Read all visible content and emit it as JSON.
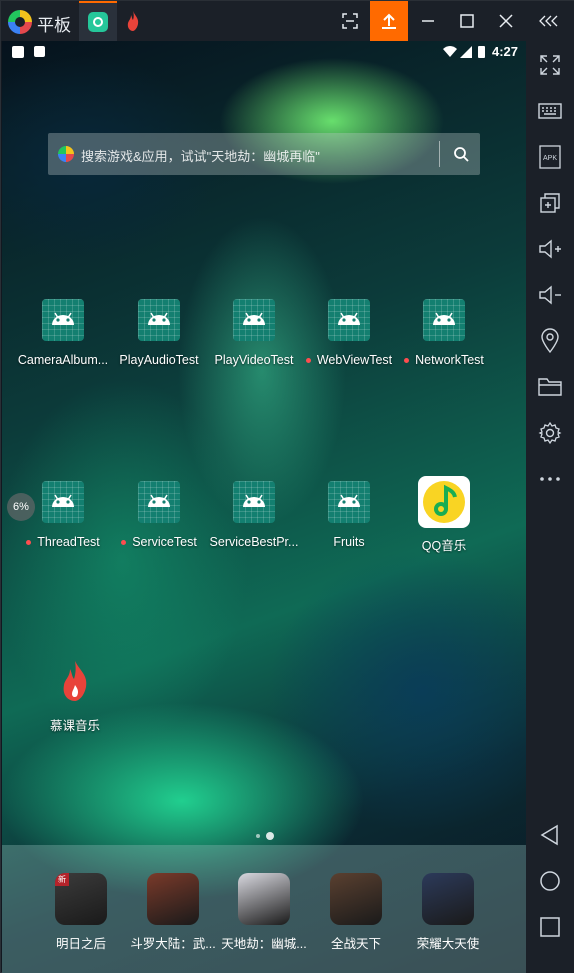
{
  "titlebar": {
    "app_title": "平板",
    "buttons": [
      "screenshot-icon",
      "upload-icon",
      "minimize-icon",
      "maximize-icon",
      "close-icon",
      "collapse-icon"
    ]
  },
  "statusbar": {
    "time": "4:27"
  },
  "search": {
    "placeholder": "搜索游戏&应用，试试\"天地劫：幽城再临\""
  },
  "apps_row1": [
    {
      "label": "CameraAlbum...",
      "dot": false
    },
    {
      "label": "PlayAudioTest",
      "dot": false
    },
    {
      "label": "PlayVideoTest",
      "dot": false
    },
    {
      "label": "WebViewTest",
      "dot": true
    },
    {
      "label": "NetworkTest",
      "dot": true
    }
  ],
  "apps_row2": [
    {
      "label": "ThreadTest",
      "dot": true
    },
    {
      "label": "ServiceTest",
      "dot": true
    },
    {
      "label": "ServiceBestPr...",
      "dot": false
    },
    {
      "label": "Fruits",
      "dot": false
    },
    {
      "label": "QQ音乐",
      "dot": false
    }
  ],
  "apps_row3": [
    {
      "label": "慕课音乐"
    }
  ],
  "progress_text": "6%",
  "dock": [
    {
      "label": "明日之后",
      "color": "#3b3b3b",
      "badge": "新"
    },
    {
      "label": "斗罗大陆：武...",
      "color": "#7a3a2a"
    },
    {
      "label": "天地劫：幽城...",
      "color": "#d9d9e0"
    },
    {
      "label": "全战天下",
      "color": "#5a4030"
    },
    {
      "label": "荣耀大天使",
      "color": "#2c3a5a"
    }
  ],
  "sidebar": [
    "fullscreen-icon",
    "keyboard-icon",
    "apk-icon",
    "multi-window-icon",
    "volume-up-icon",
    "volume-down-icon",
    "location-icon",
    "folder-icon",
    "settings-icon",
    "more-icon",
    "back-icon",
    "home-icon",
    "recent-icon"
  ],
  "colors": {
    "accent": "#ff6a00",
    "app_icon": "#16897a"
  }
}
